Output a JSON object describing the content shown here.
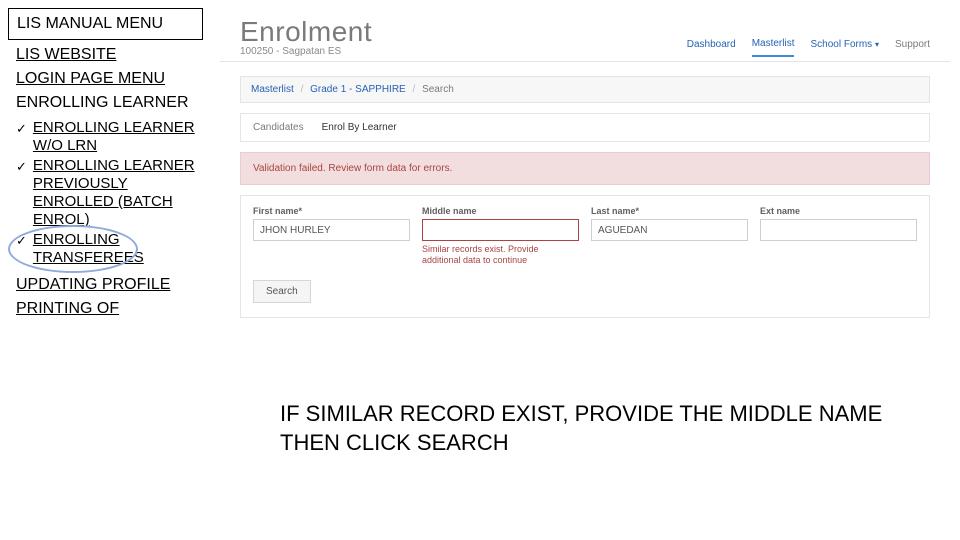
{
  "nav": {
    "manual_menu": "LIS MANUAL MENU",
    "website": "LIS WEBSITE",
    "login_menu": "LOGIN PAGE MENU",
    "enrolling_learner": "ENROLLING LEARNER",
    "sub": {
      "wo_lrn": "ENROLLING LEARNER W/O LRN",
      "batch": "ENROLLING LEARNER PREVIOUSLY ENROLLED (BATCH ENROL)",
      "transferees": "ENROLLING TRANSFEREES"
    },
    "updating_profile": "UPDATING PROFILE",
    "printing": "PRINTING OF"
  },
  "shot": {
    "title": "Enrolment",
    "subtitle": "100250 - Sagpatan ES",
    "topnav": {
      "dashboard": "Dashboard",
      "masterlist": "Masterlist",
      "schoolforms": "School Forms",
      "support": "Support"
    },
    "crumb": {
      "a": "Masterlist",
      "b": "Grade 1 - SAPPHIRE",
      "c": "Search"
    },
    "tabs": {
      "candidates": "Candidates",
      "enrol": "Enrol By Learner"
    },
    "error": "Validation failed. Review form data for errors.",
    "fields": {
      "first_label": "First name*",
      "first_value": "JHON HURLEY",
      "middle_label": "Middle name",
      "middle_msg": "Similar records exist. Provide additional data to continue",
      "last_label": "Last name*",
      "last_value": "AGUEDAN",
      "ext_label": "Ext name"
    },
    "search": "Search"
  },
  "caption": "IF SIMILAR RECORD EXIST, PROVIDE THE MIDDLE NAME THEN CLICK SEARCH"
}
